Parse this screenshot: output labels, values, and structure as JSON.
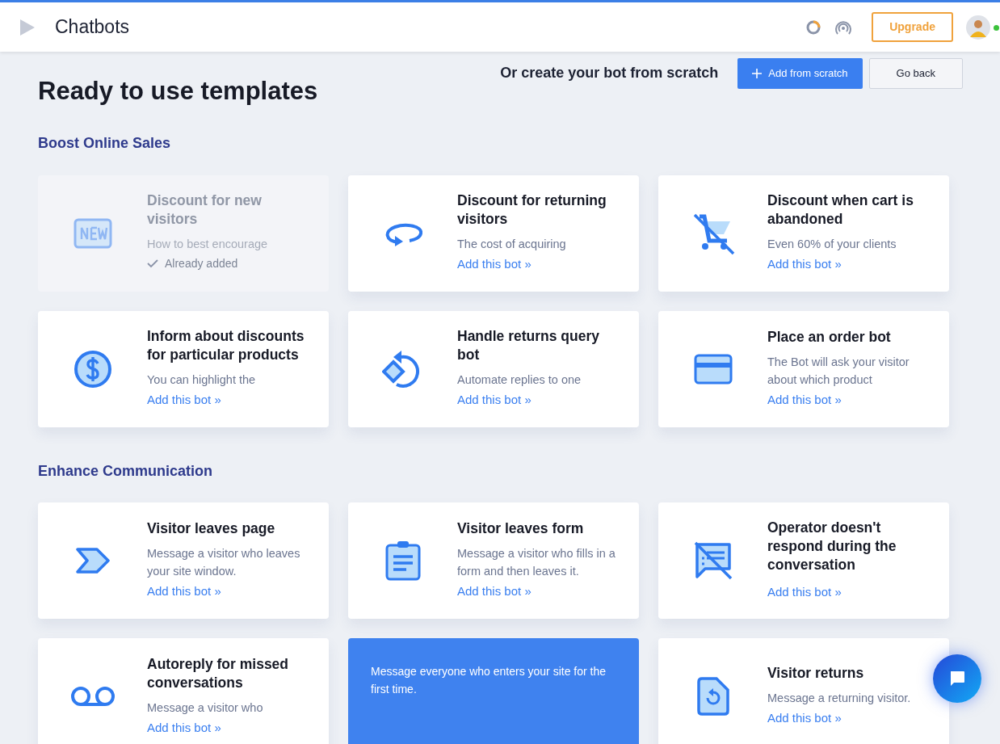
{
  "header": {
    "title": "Chatbots",
    "upgrade_button": "Upgrade",
    "online": true
  },
  "page": {
    "title": "Ready to use templates",
    "scratch_label": "Or create your bot from scratch",
    "add_button": "Add from scratch",
    "back_button": "Go back"
  },
  "sections": [
    {
      "title": "Boost Online Sales",
      "cards": [
        {
          "kind": "template",
          "title": "Discount for new visitors",
          "description": "How to best encourage",
          "added": true,
          "status": "Already added"
        },
        {
          "kind": "template",
          "title": "Discount for returning visitors",
          "description": "The cost of acquiring",
          "added": false,
          "link": "Add this bot »"
        },
        {
          "kind": "template",
          "title": "Discount when cart is abandoned",
          "description": "Even 60% of your clients",
          "added": false,
          "link": "Add this bot »"
        },
        {
          "kind": "template",
          "title": "Inform about discounts for particular products",
          "description": "You can highlight the",
          "added": false,
          "link": "Add this bot »"
        },
        {
          "kind": "template",
          "title": "Handle returns query bot",
          "description": "Automate replies to one",
          "added": false,
          "link": "Add this bot »"
        },
        {
          "kind": "template",
          "title": "Place an order bot",
          "description": "The Bot will ask your visitor about which product",
          "added": false,
          "link": "Add this bot »"
        }
      ]
    },
    {
      "title": "Enhance Communication",
      "cards": [
        {
          "kind": "template",
          "title": "Visitor leaves page",
          "description": "Message a visitor who leaves your site window.",
          "added": false,
          "link": "Add this bot »"
        },
        {
          "kind": "template",
          "title": "Visitor leaves form",
          "description": "Message a visitor who fills in a form and then leaves it.",
          "added": false,
          "link": "Add this bot »"
        },
        {
          "kind": "template",
          "title": "Operator doesn't respond during the conversation",
          "added": false,
          "link": "Add this bot »"
        },
        {
          "kind": "template",
          "title": "Autoreply for missed conversations",
          "description": "Message a visitor who",
          "added": false,
          "link": "Add this bot »"
        },
        {
          "kind": "tooltip",
          "text": "Message everyone who enters your site for the first time."
        },
        {
          "kind": "template",
          "title": "Visitor returns",
          "description": "Message a returning visitor.",
          "added": false,
          "link": "Add this bot »"
        }
      ]
    }
  ]
}
